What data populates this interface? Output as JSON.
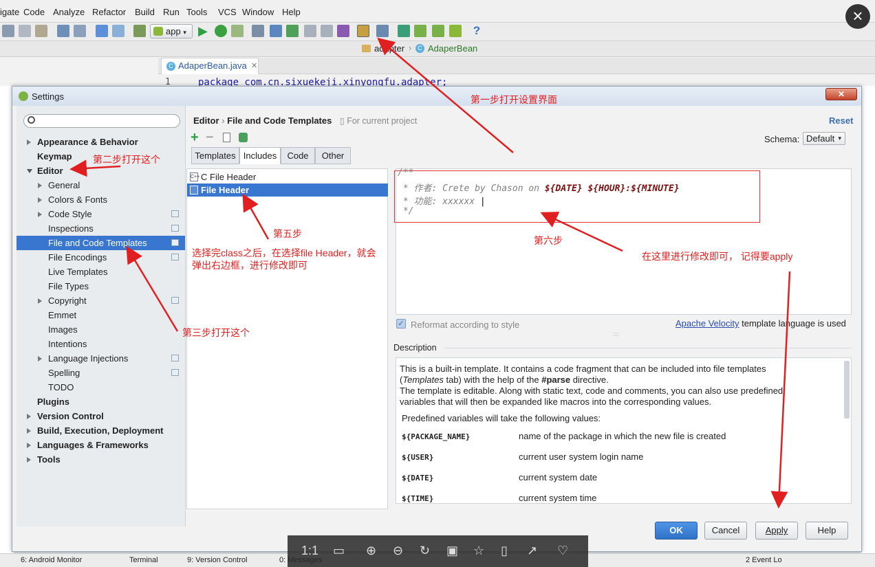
{
  "menu": [
    "igate",
    "Code",
    "Analyze",
    "Refactor",
    "Build",
    "Run",
    "Tools",
    "VCS",
    "Window",
    "Help"
  ],
  "toolbar": {
    "run_config": "app"
  },
  "navbar": {
    "folder": "adapter",
    "class": "AdaperBean"
  },
  "editor_tab": {
    "name": "AdaperBean.java",
    "line_no": "1",
    "code": "package com.cn.sixuekeji.xinyongfu.adapter;"
  },
  "dialog": {
    "title": "Settings",
    "breadcrumb": {
      "parent": "Editor",
      "sep": "›",
      "current": "File and Code Templates",
      "scope": "For current project"
    },
    "reset": "Reset",
    "schema_label": "Schema:",
    "schema_value": "Default",
    "tabs": [
      "Templates",
      "Includes",
      "Code",
      "Other"
    ],
    "tree": [
      {
        "label": "Appearance & Behavior",
        "level": 0,
        "bold": true,
        "arrow": "right"
      },
      {
        "label": "Keymap",
        "level": 0,
        "bold": true,
        "arrow": ""
      },
      {
        "label": "Editor",
        "level": 0,
        "bold": true,
        "arrow": "down"
      },
      {
        "label": "General",
        "level": 1,
        "arrow": "right"
      },
      {
        "label": "Colors & Fonts",
        "level": 1,
        "arrow": "right"
      },
      {
        "label": "Code Style",
        "level": 1,
        "arrow": "right",
        "proj": true
      },
      {
        "label": "Inspections",
        "level": 1,
        "proj": true
      },
      {
        "label": "File and Code Templates",
        "level": 1,
        "proj": true,
        "selected": true
      },
      {
        "label": "File Encodings",
        "level": 1,
        "proj": true
      },
      {
        "label": "Live Templates",
        "level": 1
      },
      {
        "label": "File Types",
        "level": 1
      },
      {
        "label": "Copyright",
        "level": 1,
        "arrow": "right",
        "proj": true
      },
      {
        "label": "Emmet",
        "level": 1
      },
      {
        "label": "Images",
        "level": 1
      },
      {
        "label": "Intentions",
        "level": 1
      },
      {
        "label": "Language Injections",
        "level": 1,
        "arrow": "right",
        "proj": true
      },
      {
        "label": "Spelling",
        "level": 1,
        "proj": true
      },
      {
        "label": "TODO",
        "level": 1
      },
      {
        "label": "Plugins",
        "level": 0,
        "bold": true
      },
      {
        "label": "Version Control",
        "level": 0,
        "bold": true,
        "arrow": "right"
      },
      {
        "label": "Build, Execution, Deployment",
        "level": 0,
        "bold": true,
        "arrow": "right"
      },
      {
        "label": "Languages & Frameworks",
        "level": 0,
        "bold": true,
        "arrow": "right"
      },
      {
        "label": "Tools",
        "level": 0,
        "bold": true,
        "arrow": "right"
      }
    ],
    "includes": [
      {
        "label": "C File Header",
        "icon": "C++"
      },
      {
        "label": "File Header",
        "selected": true
      }
    ],
    "code_lines": [
      "/**",
      " * 作者: Crete by Chason on ",
      " * 功能: xxxxxx ",
      " */"
    ],
    "code_vars": {
      "date": "${DATE}",
      "hour": "${HOUR}",
      "colon": ":",
      "minute": "${MINUTE}"
    },
    "reformat": "Reformat according to style",
    "velocity_link": "Apache Velocity",
    "velocity_rest": "template language is used",
    "description_label": "Description",
    "description": {
      "p1a": "This is a built-in template. It contains a code fragment that can be included into file templates",
      "p1b_italic": "Templates",
      "p1b_mid": " tab) with the help of the ",
      "p1b_bold": "#parse",
      "p1b_end": " directive.",
      "p2a": "The template is editable. Along with static text, code and comments, you can also use predefined",
      "p2b": "variables that will then be expanded like macros into the corresponding values.",
      "p3": "Predefined variables will take the following values:",
      "vars": [
        {
          "name": "${PACKAGE_NAME}",
          "desc": "name of the package in which the new file is created"
        },
        {
          "name": "${USER}",
          "desc": "current user system login name"
        },
        {
          "name": "${DATE}",
          "desc": "current system date"
        },
        {
          "name": "${TIME}",
          "desc": "current system time"
        }
      ]
    },
    "buttons": {
      "ok": "OK",
      "cancel": "Cancel",
      "apply": "Apply",
      "help": "Help"
    }
  },
  "annotations": {
    "step1": "第一步打开设置界面",
    "step2": "第二步打开这个",
    "step3": "第三步打开这个",
    "step5": "第五步",
    "step5_desc1": "选择完class之后，在选择file Header，就会",
    "step5_desc2": "弹出右边框，进行修改即可",
    "step6": "第六步",
    "step6_desc": "在这里进行修改即可， 记得要apply"
  },
  "statusbar": {
    "android_monitor": "6: Android Monitor",
    "terminal": "Terminal",
    "version_control": "9: Version Control",
    "messages": "0: Messages",
    "event_log": "2 Event Lo"
  },
  "viewer": {
    "ratio": "1:1"
  },
  "colors": {
    "accent": "#3876d0",
    "annotation": "#e02020"
  }
}
